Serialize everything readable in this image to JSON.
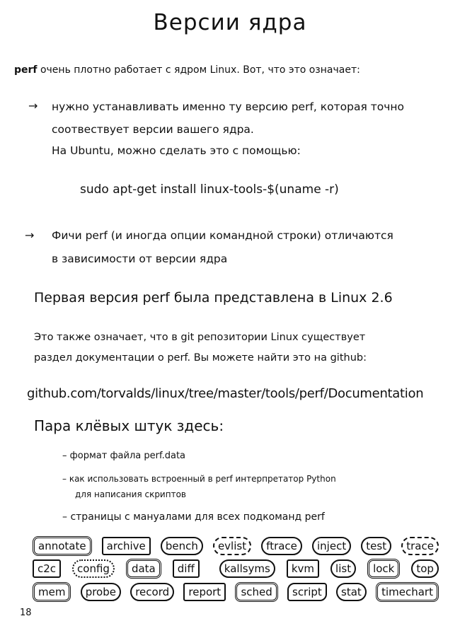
{
  "title": "Версии ядра",
  "intro": {
    "bold": "perf",
    "text": " очень плотно работает с ядром Linux. Вот, что это означает:"
  },
  "bullets": [
    {
      "arrow": "→",
      "lines": [
        "нужно устанавливать именно ту версию perf,  которая точно",
        "соотвествует версии вашего ядра.",
        "На Ubuntu, можно сделать это с помощью:"
      ]
    },
    {
      "arrow": "→",
      "lines": [
        "Фичи perf (и иногда опции командной строки) отличаются",
        "в зависимости от версии ядра"
      ]
    }
  ],
  "command": "sudo apt-get install linux-tools-$(uname -r)",
  "heading1": "Первая версия perf была представлена в Linux 2.6",
  "paragraph": [
    "Это также означает, что в git репозитории Linux существует",
    "раздел документации о perf.  Вы можете найти это на github:"
  ],
  "link": "github.com/torvalds/linux/tree/master/tools/perf/Documentation",
  "heading2": "Пара клёвых штук здесь:",
  "list": [
    {
      "dash": "–",
      "lines": [
        "формат файла perf.data"
      ]
    },
    {
      "dash": "–",
      "lines": [
        "как использовать встроенный в perf интерпретатор Python",
        "для написания скриптов"
      ]
    },
    {
      "dash": "–",
      "lines": [
        "страницы с мануалами для всех подкоманд perf"
      ]
    }
  ],
  "tags": [
    [
      "annotate",
      "archive",
      "bench",
      "evlist",
      "ftrace",
      "inject",
      "test",
      "trace"
    ],
    [
      "c2c",
      "config",
      "data",
      "diff",
      "kallsyms",
      "kvm",
      "list",
      "lock",
      "top"
    ],
    [
      "mem",
      "probe",
      "record",
      "report",
      "sched",
      "script",
      "stat",
      "timechart"
    ]
  ],
  "page_number": "18"
}
